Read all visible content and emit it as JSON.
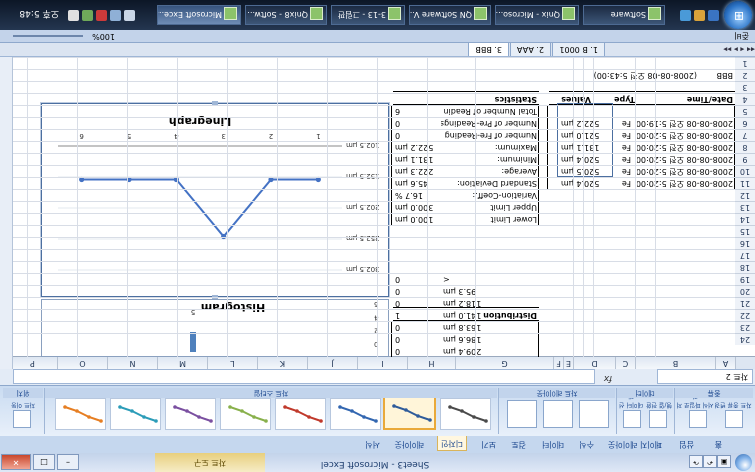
{
  "window": {
    "title": "Sheet3 - Microsoft Excel",
    "contextual_tab_group": "차트 도구",
    "controls": {
      "minimize": "–",
      "maximize": "□",
      "close": "✕"
    }
  },
  "ribbon_tabs": [
    "홈",
    "삽입",
    "페이지 레이아웃",
    "수식",
    "데이터",
    "검토",
    "보기",
    "디자인",
    "레이아웃",
    "서식"
  ],
  "active_tab": "디자인",
  "ribbon_groups": {
    "type": {
      "label": "종류",
      "buttons": [
        "차트 종류 변경",
        "서식 파일로 저장"
      ]
    },
    "data": {
      "label": "데이터",
      "buttons": [
        "행/열 전환",
        "데이터 선택"
      ]
    },
    "layout": {
      "label": "차트 레이아웃"
    },
    "styles": {
      "label": "차트 스타일",
      "colors": [
        "#4a4a4a",
        "#2e5b9a",
        "#3266b0",
        "#c0392b",
        "#88b04b",
        "#7a4fa0",
        "#2b9cb8",
        "#e67e22"
      ]
    },
    "location": {
      "label": "위치",
      "button": "차트 이동"
    }
  },
  "name_box": "차트 2",
  "fx_label": "fx",
  "columns": [
    "A",
    "B",
    "C",
    "D",
    "E",
    "F",
    "G",
    "H",
    "I",
    "J",
    "K",
    "L",
    "M",
    "N",
    "O",
    "P"
  ],
  "rows": [
    "1",
    "2",
    "3",
    "4",
    "5",
    "6",
    "7",
    "8",
    "9",
    "10",
    "11",
    "12",
    "13",
    "14",
    "15",
    "16",
    "17",
    "18",
    "19",
    "20",
    "21",
    "22",
    "23",
    "24"
  ],
  "sheet": {
    "title_row": {
      "a": "BBB",
      "b": "(2008-08-08 오전 5:43:00)"
    },
    "data_table": {
      "headers": [
        "Date/Time",
        "Type",
        "Values"
      ],
      "rows": [
        [
          "2008-08-08 오전 5:19:00",
          "Fe",
          "522.2 µm"
        ],
        [
          "2008-08-08 오전 5:20:00",
          "Fe",
          "521.0 µm"
        ],
        [
          "2008-08-08 오전 5:20:00",
          "Fe",
          "131.1 µm"
        ],
        [
          "2008-08-08 오전 5:20:00",
          "Fe",
          "520.4 µm"
        ],
        [
          "2008-08-08 오전 5:20:00",
          "Fe",
          "520.5 µm"
        ],
        [
          "2008-08-08 오전 5:20:00",
          "Fe",
          "520.4 µm"
        ]
      ]
    },
    "statistics": {
      "header": "Statistics",
      "rows": [
        [
          "Total Number of Readin",
          "6"
        ],
        [
          "Number of Pre-Readings",
          "0"
        ],
        [
          "Number of Fre-Reading",
          "0"
        ],
        [
          "Maximum:",
          "522.2 µm"
        ],
        [
          "Minimum:",
          "131.1 µm"
        ],
        [
          "Average:",
          "222.3 µm"
        ],
        [
          "Standard Deviation:",
          "45.6 µm"
        ],
        [
          "Variation-Coeff.:",
          "16.7 %"
        ],
        [
          "Upper Limit",
          "300.0 µm"
        ],
        [
          "Lower Limit",
          "100.0 µm"
        ]
      ]
    },
    "distribution": {
      "header": "Distribution",
      "rows": [
        [
          "<",
          "0"
        ],
        [
          "95.3 µm",
          "0"
        ],
        [
          "118.2 µm",
          "0"
        ],
        [
          "141.0 µm",
          "1"
        ],
        [
          "163.8 µm",
          "0"
        ],
        [
          "186.6 µm",
          "0"
        ],
        [
          "209.4 µm",
          "0"
        ]
      ]
    }
  },
  "sheet_tabs": [
    "1. B 0001",
    "2. AAA",
    "3. BBB"
  ],
  "active_sheet": "3. BBB",
  "status": {
    "left": "준비",
    "zoom": "100%"
  },
  "taskbar": {
    "items": [
      "Software",
      "Qnix - Microso...",
      "QN Software V...",
      "3-13 - 그림판",
      "Qnix8 - Softw...",
      "Microsoft Exce..."
    ],
    "active": "Microsoft Exce...",
    "clock": "오후 5:48"
  },
  "chart_data": [
    {
      "type": "line",
      "title": "Linegraph",
      "categories": [
        "1",
        "2",
        "3",
        "4",
        "5",
        "6"
      ],
      "values": [
        522.2,
        521.0,
        131.1,
        520.4,
        520.5,
        520.4
      ],
      "ylabels": [
        "102.5 µm",
        "152.5 µm",
        "202.5 µm",
        "252.5 µm",
        "302.5 µm"
      ],
      "ylim": [
        102.5,
        302.5
      ],
      "color": "#4472c4"
    },
    {
      "type": "bar",
      "title": "Histogram",
      "categories": [
        "5"
      ],
      "values": [
        1
      ],
      "ylabels": [
        "0",
        "2",
        "4",
        "6"
      ],
      "ylim": [
        0,
        6
      ],
      "color": "#4f81bd"
    }
  ]
}
